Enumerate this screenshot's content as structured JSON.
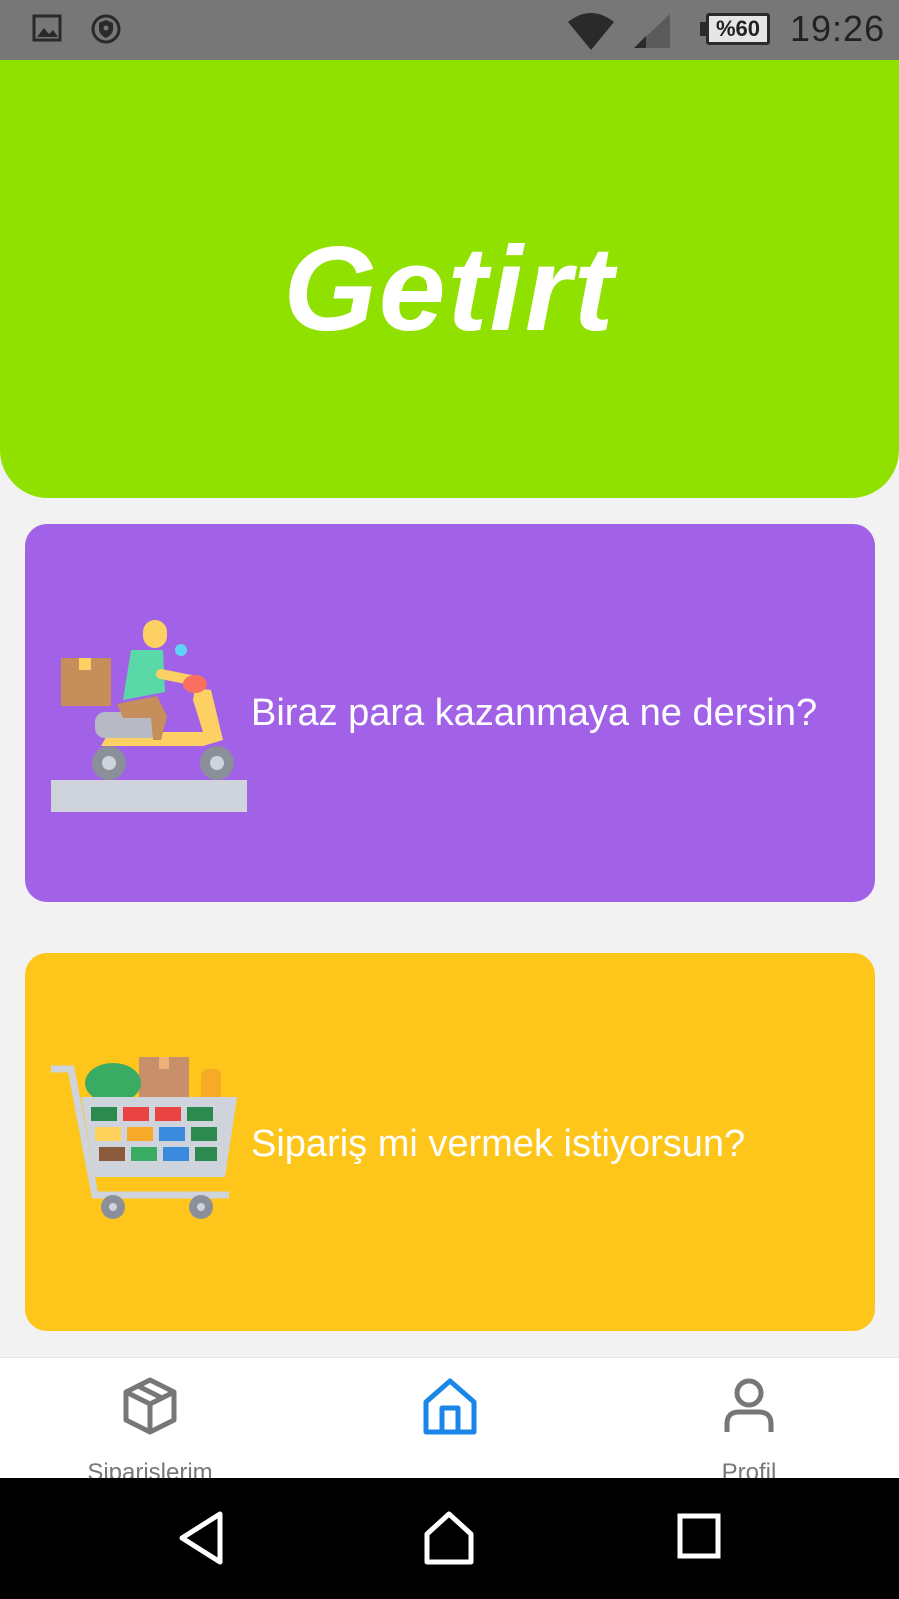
{
  "status_bar": {
    "icons": [
      "image-icon",
      "shield-icon",
      "wifi-icon",
      "signal-icon"
    ],
    "battery": "%60",
    "time": "19:26"
  },
  "hero": {
    "brand": "Getirt",
    "color": "#90e000"
  },
  "cards": [
    {
      "icon": "courier-scooter-illustration",
      "text": "Biraz para kazanmaya ne dersin?",
      "color": "#a262e8"
    },
    {
      "icon": "shopping-cart-illustration",
      "text": "Sipariş mi vermek istiyorsun?",
      "color": "#fec61a"
    }
  ],
  "bottom_nav": {
    "items": [
      {
        "icon": "package-icon",
        "label": "Siparişlerim",
        "active": false
      },
      {
        "icon": "home-icon",
        "label": "",
        "active": true
      },
      {
        "icon": "user-icon",
        "label": "Profil",
        "active": false
      }
    ],
    "active_color": "#1a86e8",
    "inactive_color": "#777777"
  },
  "system_nav": {
    "buttons": [
      "back-icon",
      "home-outline-icon",
      "recents-icon"
    ]
  }
}
